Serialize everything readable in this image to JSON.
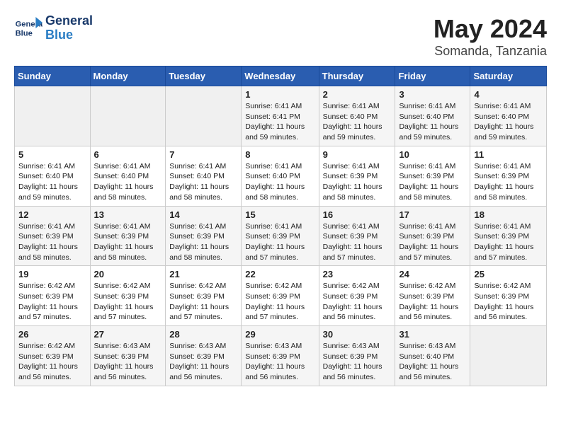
{
  "header": {
    "logo_line1": "General",
    "logo_line2": "Blue",
    "month_year": "May 2024",
    "location": "Somanda, Tanzania"
  },
  "days_of_week": [
    "Sunday",
    "Monday",
    "Tuesday",
    "Wednesday",
    "Thursday",
    "Friday",
    "Saturday"
  ],
  "weeks": [
    [
      {
        "day": "",
        "info": ""
      },
      {
        "day": "",
        "info": ""
      },
      {
        "day": "",
        "info": ""
      },
      {
        "day": "1",
        "info": "Sunrise: 6:41 AM\nSunset: 6:41 PM\nDaylight: 11 hours\nand 59 minutes."
      },
      {
        "day": "2",
        "info": "Sunrise: 6:41 AM\nSunset: 6:40 PM\nDaylight: 11 hours\nand 59 minutes."
      },
      {
        "day": "3",
        "info": "Sunrise: 6:41 AM\nSunset: 6:40 PM\nDaylight: 11 hours\nand 59 minutes."
      },
      {
        "day": "4",
        "info": "Sunrise: 6:41 AM\nSunset: 6:40 PM\nDaylight: 11 hours\nand 59 minutes."
      }
    ],
    [
      {
        "day": "5",
        "info": "Sunrise: 6:41 AM\nSunset: 6:40 PM\nDaylight: 11 hours\nand 59 minutes."
      },
      {
        "day": "6",
        "info": "Sunrise: 6:41 AM\nSunset: 6:40 PM\nDaylight: 11 hours\nand 58 minutes."
      },
      {
        "day": "7",
        "info": "Sunrise: 6:41 AM\nSunset: 6:40 PM\nDaylight: 11 hours\nand 58 minutes."
      },
      {
        "day": "8",
        "info": "Sunrise: 6:41 AM\nSunset: 6:40 PM\nDaylight: 11 hours\nand 58 minutes."
      },
      {
        "day": "9",
        "info": "Sunrise: 6:41 AM\nSunset: 6:39 PM\nDaylight: 11 hours\nand 58 minutes."
      },
      {
        "day": "10",
        "info": "Sunrise: 6:41 AM\nSunset: 6:39 PM\nDaylight: 11 hours\nand 58 minutes."
      },
      {
        "day": "11",
        "info": "Sunrise: 6:41 AM\nSunset: 6:39 PM\nDaylight: 11 hours\nand 58 minutes."
      }
    ],
    [
      {
        "day": "12",
        "info": "Sunrise: 6:41 AM\nSunset: 6:39 PM\nDaylight: 11 hours\nand 58 minutes."
      },
      {
        "day": "13",
        "info": "Sunrise: 6:41 AM\nSunset: 6:39 PM\nDaylight: 11 hours\nand 58 minutes."
      },
      {
        "day": "14",
        "info": "Sunrise: 6:41 AM\nSunset: 6:39 PM\nDaylight: 11 hours\nand 58 minutes."
      },
      {
        "day": "15",
        "info": "Sunrise: 6:41 AM\nSunset: 6:39 PM\nDaylight: 11 hours\nand 57 minutes."
      },
      {
        "day": "16",
        "info": "Sunrise: 6:41 AM\nSunset: 6:39 PM\nDaylight: 11 hours\nand 57 minutes."
      },
      {
        "day": "17",
        "info": "Sunrise: 6:41 AM\nSunset: 6:39 PM\nDaylight: 11 hours\nand 57 minutes."
      },
      {
        "day": "18",
        "info": "Sunrise: 6:41 AM\nSunset: 6:39 PM\nDaylight: 11 hours\nand 57 minutes."
      }
    ],
    [
      {
        "day": "19",
        "info": "Sunrise: 6:42 AM\nSunset: 6:39 PM\nDaylight: 11 hours\nand 57 minutes."
      },
      {
        "day": "20",
        "info": "Sunrise: 6:42 AM\nSunset: 6:39 PM\nDaylight: 11 hours\nand 57 minutes."
      },
      {
        "day": "21",
        "info": "Sunrise: 6:42 AM\nSunset: 6:39 PM\nDaylight: 11 hours\nand 57 minutes."
      },
      {
        "day": "22",
        "info": "Sunrise: 6:42 AM\nSunset: 6:39 PM\nDaylight: 11 hours\nand 57 minutes."
      },
      {
        "day": "23",
        "info": "Sunrise: 6:42 AM\nSunset: 6:39 PM\nDaylight: 11 hours\nand 56 minutes."
      },
      {
        "day": "24",
        "info": "Sunrise: 6:42 AM\nSunset: 6:39 PM\nDaylight: 11 hours\nand 56 minutes."
      },
      {
        "day": "25",
        "info": "Sunrise: 6:42 AM\nSunset: 6:39 PM\nDaylight: 11 hours\nand 56 minutes."
      }
    ],
    [
      {
        "day": "26",
        "info": "Sunrise: 6:42 AM\nSunset: 6:39 PM\nDaylight: 11 hours\nand 56 minutes."
      },
      {
        "day": "27",
        "info": "Sunrise: 6:43 AM\nSunset: 6:39 PM\nDaylight: 11 hours\nand 56 minutes."
      },
      {
        "day": "28",
        "info": "Sunrise: 6:43 AM\nSunset: 6:39 PM\nDaylight: 11 hours\nand 56 minutes."
      },
      {
        "day": "29",
        "info": "Sunrise: 6:43 AM\nSunset: 6:39 PM\nDaylight: 11 hours\nand 56 minutes."
      },
      {
        "day": "30",
        "info": "Sunrise: 6:43 AM\nSunset: 6:39 PM\nDaylight: 11 hours\nand 56 minutes."
      },
      {
        "day": "31",
        "info": "Sunrise: 6:43 AM\nSunset: 6:40 PM\nDaylight: 11 hours\nand 56 minutes."
      },
      {
        "day": "",
        "info": ""
      }
    ]
  ]
}
